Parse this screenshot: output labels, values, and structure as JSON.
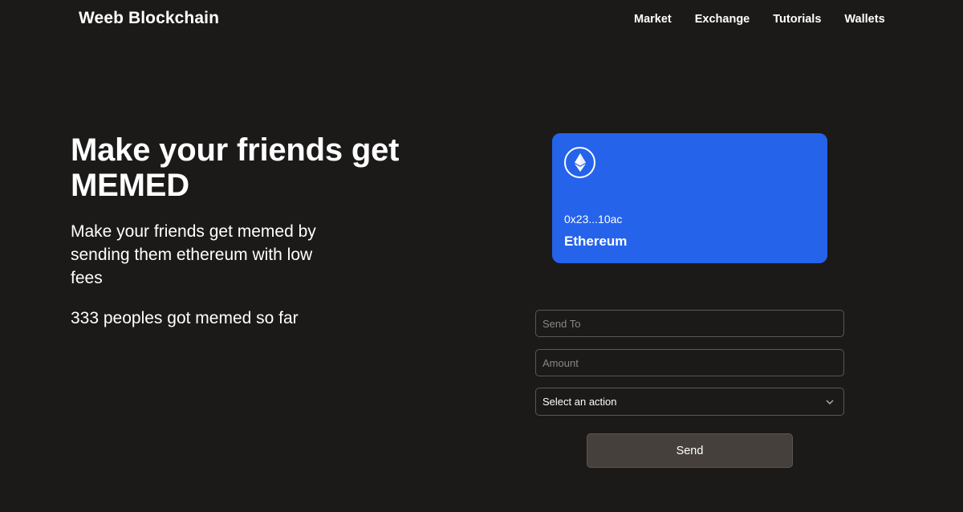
{
  "navbar": {
    "brand": "Weeb Blockchain",
    "links": [
      {
        "label": "Market"
      },
      {
        "label": "Exchange"
      },
      {
        "label": "Tutorials"
      },
      {
        "label": "Wallets"
      }
    ]
  },
  "hero": {
    "title": "Make your friends get MEMED",
    "subtitle": "Make your friends get memed by sending them ethereum with low fees",
    "count_text": "333 peoples got memed so far"
  },
  "card": {
    "icon": "ethereum-icon",
    "address": "0x23...10ac",
    "network": "Ethereum",
    "color": "#2563eb"
  },
  "form": {
    "send_to_placeholder": "Send To",
    "amount_placeholder": "Amount",
    "action_select_value": "Select an action",
    "send_label": "Send"
  },
  "colors": {
    "background": "#1c1a19",
    "button": "#45403b"
  }
}
